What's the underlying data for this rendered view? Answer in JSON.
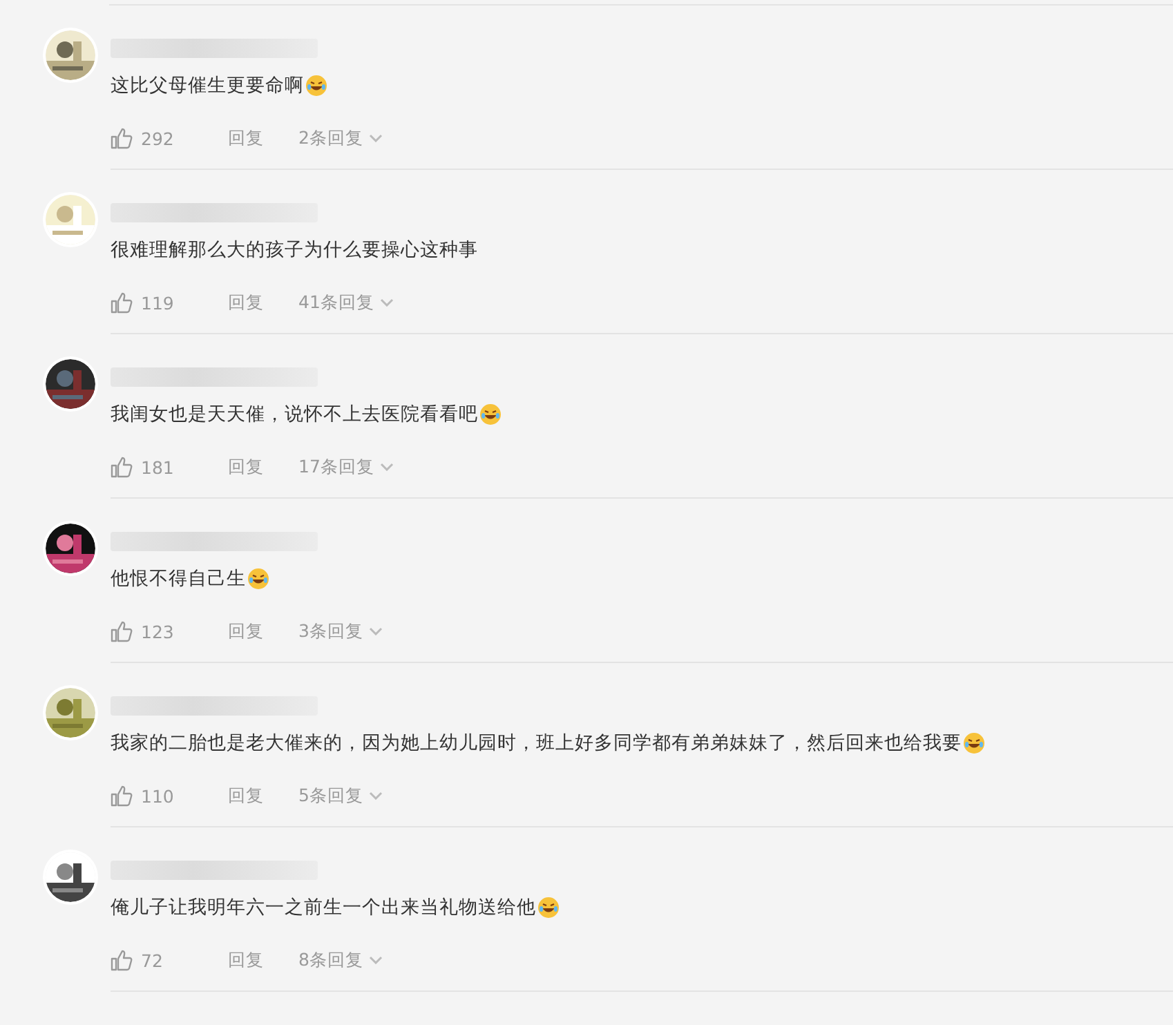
{
  "comments": [
    {
      "text": "这比父母催生更要命啊",
      "emoji": true,
      "likes": "292",
      "reply": "回复",
      "reply_count": "2条回复"
    },
    {
      "text": "很难理解那么大的孩子为什么要操心这种事",
      "emoji": false,
      "likes": "119",
      "reply": "回复",
      "reply_count": "41条回复"
    },
    {
      "text": "我闺女也是天天催，说怀不上去医院看看吧",
      "emoji": true,
      "likes": "181",
      "reply": "回复",
      "reply_count": "17条回复"
    },
    {
      "text": "他恨不得自己生",
      "emoji": true,
      "likes": "123",
      "reply": "回复",
      "reply_count": "3条回复"
    },
    {
      "text": "我家的二胎也是老大催来的，因为她上幼儿园时，班上好多同学都有弟弟妹妹了，然后回来也给我要",
      "emoji": true,
      "likes": "110",
      "reply": "回复",
      "reply_count": "5条回复"
    },
    {
      "text": "俺儿子让我明年六一之前生一个出来当礼物送给他",
      "emoji": true,
      "likes": "72",
      "reply": "回复",
      "reply_count": "8条回复"
    }
  ]
}
